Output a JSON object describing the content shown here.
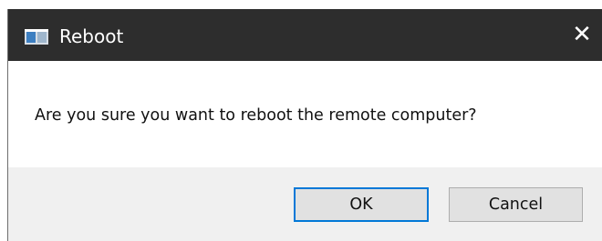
{
  "window": {
    "title": "Reboot",
    "close_glyph": "✕",
    "app_icon": "window-app-icon",
    "close_icon": "close-icon"
  },
  "dialog": {
    "message": "Are you sure you want to reboot the remote computer?"
  },
  "buttons": {
    "ok_label": "OK",
    "cancel_label": "Cancel"
  },
  "colors": {
    "titlebar": "#2d2d2d",
    "footer": "#f0f0f0",
    "focus_border": "#0078d7"
  }
}
